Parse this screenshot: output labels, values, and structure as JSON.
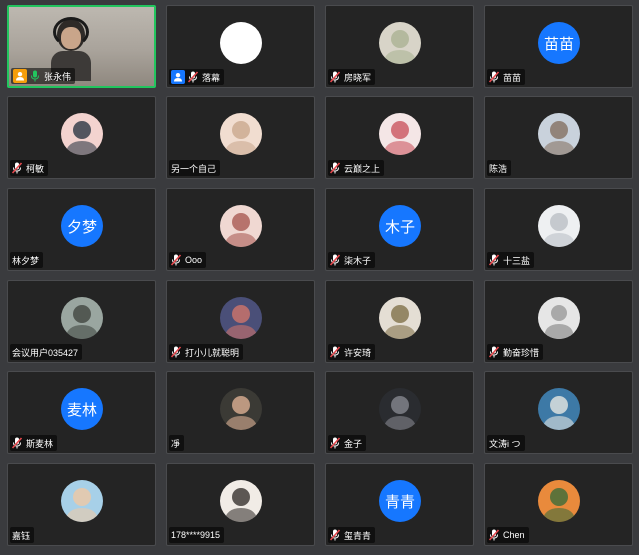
{
  "participants": [
    {
      "name": "张永伟",
      "mic": "on",
      "badge": "orange",
      "avatar_type": "video",
      "avatar_text": "",
      "avatar_colors": []
    },
    {
      "name": "落幕",
      "mic": "off",
      "badge": "blue",
      "avatar_type": "white",
      "avatar_text": "",
      "avatar_colors": []
    },
    {
      "name": "房晓军",
      "mic": "off",
      "badge": "",
      "avatar_type": "photo",
      "avatar_text": "",
      "avatar_colors": [
        "#d8d4c8",
        "#a8b090"
      ]
    },
    {
      "name": "苗苗",
      "mic": "off",
      "badge": "",
      "avatar_type": "text",
      "avatar_text": "苗苗",
      "avatar_colors": []
    },
    {
      "name": "柯敏",
      "mic": "off",
      "badge": "",
      "avatar_type": "photo",
      "avatar_text": "",
      "avatar_colors": [
        "#f3d3cf",
        "#1e2b3a"
      ]
    },
    {
      "name": "另一个自己",
      "mic": "none",
      "badge": "",
      "avatar_type": "photo",
      "avatar_text": "",
      "avatar_colors": [
        "#f1ddd0",
        "#c7a48a"
      ]
    },
    {
      "name": "云巅之上",
      "mic": "off",
      "badge": "",
      "avatar_type": "photo",
      "avatar_text": "",
      "avatar_colors": [
        "#f4e6e6",
        "#c84b55"
      ]
    },
    {
      "name": "陈浩",
      "mic": "none",
      "badge": "",
      "avatar_type": "photo",
      "avatar_text": "",
      "avatar_colors": [
        "#c9d2dc",
        "#7f6a5a"
      ]
    },
    {
      "name": "林夕梦",
      "mic": "none",
      "badge": "",
      "avatar_type": "text",
      "avatar_text": "夕梦",
      "avatar_colors": []
    },
    {
      "name": "Ooo",
      "mic": "off",
      "badge": "",
      "avatar_type": "photo",
      "avatar_text": "",
      "avatar_colors": [
        "#f0d8d2",
        "#a4524a"
      ]
    },
    {
      "name": "柒木子",
      "mic": "off",
      "badge": "",
      "avatar_type": "text",
      "avatar_text": "木子",
      "avatar_colors": []
    },
    {
      "name": "十三盐",
      "mic": "off",
      "badge": "",
      "avatar_type": "photo",
      "avatar_text": "",
      "avatar_colors": [
        "#eef0f2",
        "#b7bcc2"
      ]
    },
    {
      "name": "会议用户035427",
      "mic": "none",
      "badge": "",
      "avatar_type": "photo",
      "avatar_text": "",
      "avatar_colors": [
        "#9aa6a0",
        "#3b3f3a"
      ]
    },
    {
      "name": "打小儿就聪明",
      "mic": "off",
      "badge": "",
      "avatar_type": "photo",
      "avatar_text": "",
      "avatar_colors": [
        "#4a4f78",
        "#d9776a"
      ]
    },
    {
      "name": "许安琦",
      "mic": "off",
      "badge": "",
      "avatar_type": "photo",
      "avatar_text": "",
      "avatar_colors": [
        "#e4ded4",
        "#7a6a40"
      ]
    },
    {
      "name": "勤奋珍惜",
      "mic": "off",
      "badge": "",
      "avatar_type": "default",
      "avatar_text": "",
      "avatar_colors": [
        "#e6e6e6",
        "#a9a9a9"
      ]
    },
    {
      "name": "斯麦林",
      "mic": "off",
      "badge": "",
      "avatar_type": "text",
      "avatar_text": "麦林",
      "avatar_colors": []
    },
    {
      "name": "凈",
      "mic": "none",
      "badge": "",
      "avatar_type": "photo",
      "avatar_text": "",
      "avatar_colors": [
        "#3b3a35",
        "#e8b89a"
      ]
    },
    {
      "name": "金子",
      "mic": "off",
      "badge": "",
      "avatar_type": "photo",
      "avatar_text": "",
      "avatar_colors": [
        "#2a2c30",
        "#8c8e95"
      ]
    },
    {
      "name": "文涛i つ",
      "mic": "none",
      "badge": "",
      "avatar_type": "photo",
      "avatar_text": "",
      "avatar_colors": [
        "#3d79a6",
        "#f2efe6"
      ]
    },
    {
      "name": "嘉钰",
      "mic": "none",
      "badge": "",
      "avatar_type": "photo",
      "avatar_text": "",
      "avatar_colors": [
        "#a7d0e8",
        "#f4c8a0"
      ]
    },
    {
      "name": "178****9915",
      "mic": "none",
      "badge": "",
      "avatar_type": "photo",
      "avatar_text": "",
      "avatar_colors": [
        "#f1ece6",
        "#2a2622"
      ]
    },
    {
      "name": "玺青青",
      "mic": "off",
      "badge": "",
      "avatar_type": "text",
      "avatar_text": "青青",
      "avatar_colors": []
    },
    {
      "name": "Chen",
      "mic": "off",
      "badge": "",
      "avatar_type": "photo",
      "avatar_text": "",
      "avatar_colors": [
        "#e98a3c",
        "#2f6a3a"
      ]
    }
  ],
  "colors": {
    "accent": "#1677ff",
    "active_speaker": "#22c55e",
    "mic_muted": "#e5484d",
    "host": "#f59e0b"
  }
}
